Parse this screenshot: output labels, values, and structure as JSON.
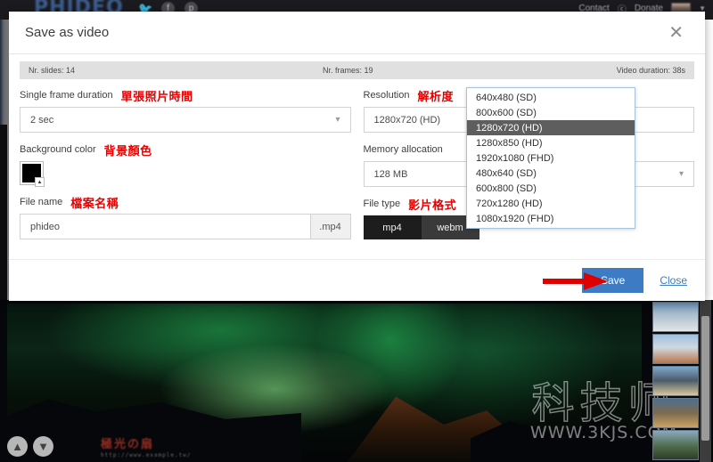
{
  "background_page": {
    "logo_text": "PHIDEO",
    "social_icons": [
      "twitter-icon",
      "facebook-icon",
      "pinterest-icon"
    ],
    "nav": {
      "contact_label": "Contact",
      "donate_label": "Donate",
      "donate_icon": "dollar-circle-icon",
      "flag_icon": "flag-icon",
      "caret_icon": "chevron-down-icon"
    }
  },
  "dialog": {
    "title": "Save as video",
    "close_icon": "close-icon",
    "stats": {
      "slides": "Nr. slides: 14",
      "frames": "Nr. frames: 19",
      "duration": "Video duration: 38s"
    },
    "fields": {
      "single_frame_duration": {
        "label": "Single frame duration",
        "annotation": "單張照片時間",
        "value": "2 sec",
        "chevron_icon": "chevron-down-icon"
      },
      "background_color": {
        "label": "Background color",
        "annotation": "背景顏色",
        "value": "#000000",
        "picker_icon": "color-picker-triangle-icon"
      },
      "file_name": {
        "label": "File name",
        "annotation": "檔案名稱",
        "value": "phideo",
        "placeholder": "phideo",
        "extension": ".mp4"
      },
      "resolution": {
        "label": "Resolution",
        "annotation": "解析度",
        "value": "1280x720 (HD)",
        "options": [
          "640x480 (SD)",
          "800x600 (SD)",
          "1280x720 (HD)",
          "1280x850 (HD)",
          "1920x1080 (FHD)",
          "480x640 (SD)",
          "600x800 (SD)",
          "720x1280 (HD)",
          "1080x1920 (FHD)"
        ],
        "selected_option": "1280x720 (HD)",
        "is_open": true
      },
      "memory_allocation": {
        "label": "Memory allocation",
        "value": "128 MB",
        "chevron_icon": "chevron-down-icon"
      },
      "file_type": {
        "label": "File type",
        "annotation": "影片格式",
        "options": [
          "mp4",
          "webm"
        ],
        "selected": "mp4"
      }
    },
    "footer": {
      "save_label": "Save",
      "close_label": "Close",
      "save_color": "#3d7cc4",
      "arrow_color": "#e00000",
      "arrow_icon": "red-arrow-right-icon"
    }
  },
  "viewer": {
    "prev_icon": "chevron-up-circle-icon",
    "next_icon": "chevron-down-circle-icon",
    "photo_credit_cn": "極光の扇",
    "photo_credit_url": "http://www.example.tw/",
    "watermark_cn": "科技师",
    "watermark_url": "WWW.3KJS.COM",
    "thumbnails": [
      "thumbnail-1",
      "thumbnail-2",
      "thumbnail-3",
      "thumbnail-4",
      "thumbnail-5"
    ]
  }
}
